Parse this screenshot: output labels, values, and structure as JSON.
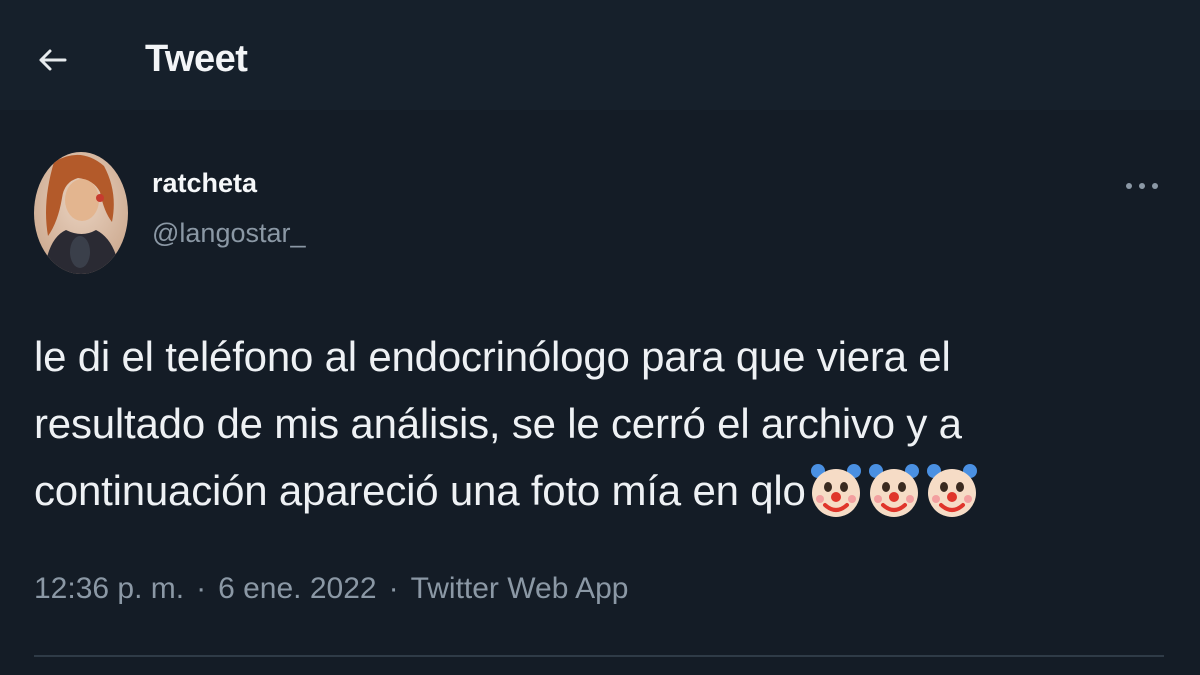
{
  "header": {
    "title": "Tweet",
    "back_icon": "arrow-left-icon"
  },
  "author": {
    "display_name": "ratcheta",
    "handle": "@langostar_",
    "more_icon": "more-horizontal-icon"
  },
  "tweet": {
    "text_lines": [
      "le di el teléfono al endocrinólogo para que viera el",
      "resultado de mis análisis, se le cerró el archivo y a",
      "continuación apareció una foto mía en qlo"
    ],
    "emojis": [
      "clown-face-emoji",
      "clown-face-emoji",
      "clown-face-emoji"
    ]
  },
  "meta": {
    "time": "12:36 p. m.",
    "separator": "·",
    "date": "6 ene. 2022",
    "source": "Twitter Web App"
  },
  "colors": {
    "background": "#141c26",
    "text_primary": "#eef1f4",
    "text_secondary": "#8b98a5",
    "divider": "#2f3b47"
  }
}
